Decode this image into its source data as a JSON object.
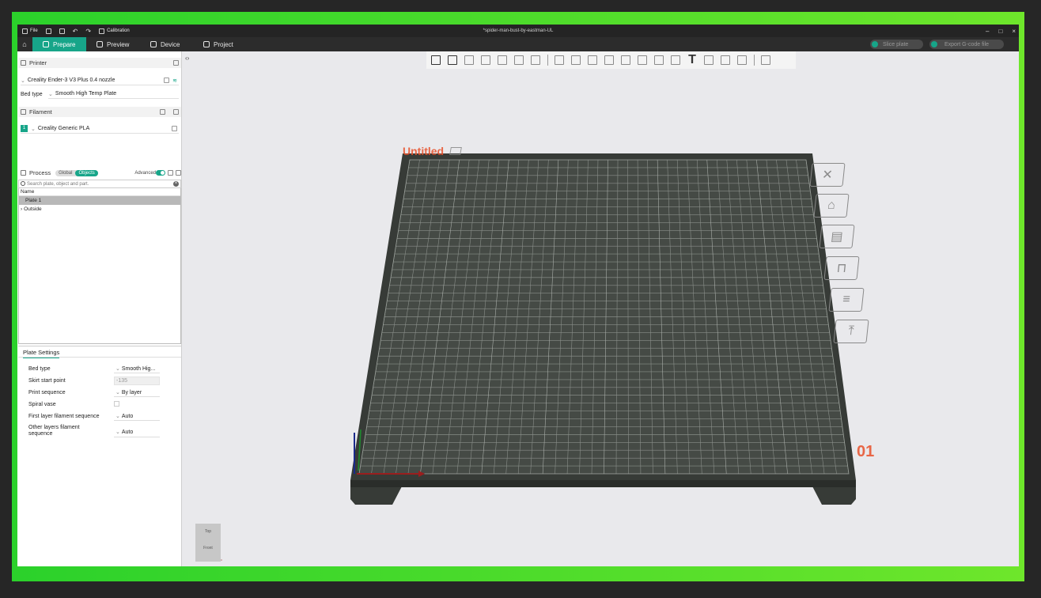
{
  "window": {
    "title": "*spider-man-bust-by-eastman-UL",
    "menu": {
      "file": "File",
      "calibration": "Calibration"
    },
    "controls": [
      "–",
      "□",
      "×"
    ]
  },
  "tabs": [
    {
      "label": "Prepare",
      "icon": "cube-icon",
      "active": true
    },
    {
      "label": "Preview",
      "icon": "layers-icon",
      "active": false
    },
    {
      "label": "Device",
      "icon": "printer-icon",
      "active": false
    },
    {
      "label": "Project",
      "icon": "project-icon",
      "active": false
    }
  ],
  "actions": {
    "slice": "Slice plate",
    "export": "Export G-code file"
  },
  "printer": {
    "heading": "Printer",
    "name": "Creality Ender-3 V3 Plus 0.4 nozzle",
    "bed_type_label": "Bed type",
    "bed_type_value": "Smooth High Temp Plate"
  },
  "filament": {
    "heading": "Filament",
    "slot": "1",
    "name": "Creality Generic PLA"
  },
  "process": {
    "heading": "Process",
    "mode_global": "Global",
    "mode_objects": "Objects",
    "advanced_label": "Advanced",
    "search_placeholder": "Search plate, object and part."
  },
  "object_list": {
    "header": "Name",
    "rows": [
      "Plate 1",
      "Outside"
    ]
  },
  "plate_settings": {
    "title": "Plate Settings",
    "bed_type": {
      "label": "Bed type",
      "value": "Smooth Hig..."
    },
    "skirt": {
      "label": "Skirt start point",
      "value": "-135"
    },
    "print_seq": {
      "label": "Print sequence",
      "value": "By layer"
    },
    "spiral": {
      "label": "Spiral vase"
    },
    "first_layer": {
      "label": "First layer filament sequence",
      "value": "Auto"
    },
    "other_layers": {
      "label": "Other layers filament sequence",
      "value": "Auto"
    }
  },
  "viewport": {
    "plate_name": "Untitled",
    "plate_number": "01",
    "navcube_top": "Top",
    "navcube_front": "Front",
    "colors": {
      "accent": "#17a589",
      "plate": "#3a3f3a",
      "label": "#e8502a"
    }
  }
}
